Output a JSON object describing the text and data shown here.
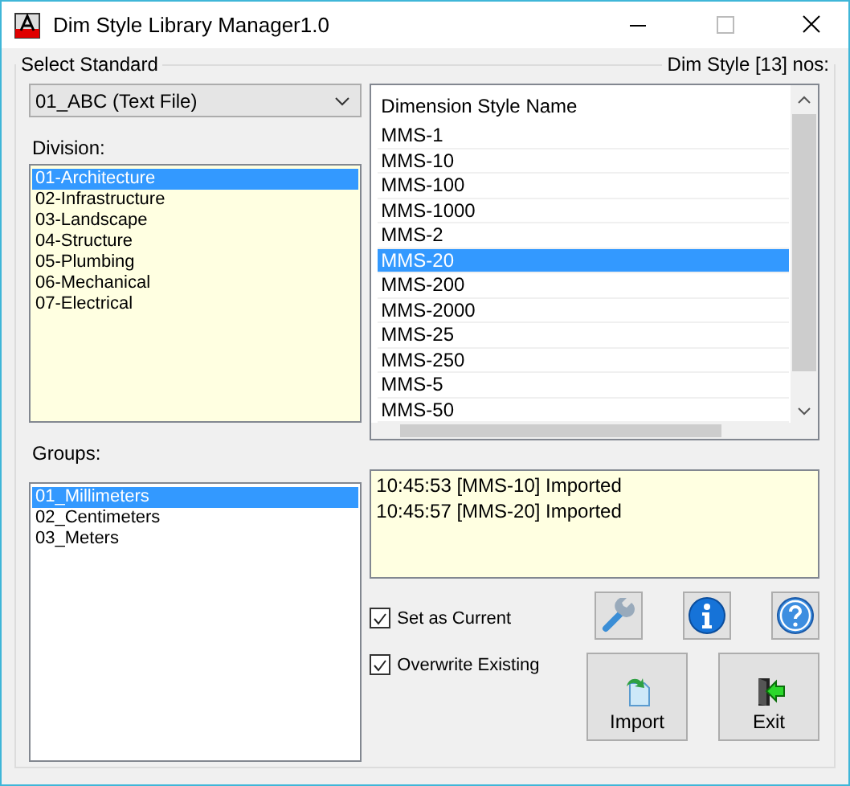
{
  "window": {
    "title": "Dim Style Library Manager1.0"
  },
  "standard": {
    "label": "Select Standard",
    "value": "01_ABC (Text File)"
  },
  "division": {
    "label": "Division:",
    "items": [
      {
        "text": "01-Architecture",
        "selected": true
      },
      {
        "text": "02-Infrastructure",
        "selected": false
      },
      {
        "text": "03-Landscape",
        "selected": false
      },
      {
        "text": "04-Structure",
        "selected": false
      },
      {
        "text": "05-Plumbing",
        "selected": false
      },
      {
        "text": "06-Mechanical",
        "selected": false
      },
      {
        "text": "07-Electrical",
        "selected": false
      }
    ]
  },
  "groups": {
    "label": "Groups:",
    "items": [
      {
        "text": "01_Millimeters",
        "selected": true
      },
      {
        "text": "02_Centimeters",
        "selected": false
      },
      {
        "text": "03_Meters",
        "selected": false
      }
    ]
  },
  "styles": {
    "count_label": "Dim Style [13] nos:",
    "column": "Dimension Style Name",
    "items": [
      {
        "text": "MMS-1",
        "selected": false
      },
      {
        "text": "MMS-10",
        "selected": false
      },
      {
        "text": "MMS-100",
        "selected": false
      },
      {
        "text": "MMS-1000",
        "selected": false
      },
      {
        "text": "MMS-2",
        "selected": false
      },
      {
        "text": "MMS-20",
        "selected": true
      },
      {
        "text": "MMS-200",
        "selected": false
      },
      {
        "text": "MMS-2000",
        "selected": false
      },
      {
        "text": "MMS-25",
        "selected": false
      },
      {
        "text": "MMS-250",
        "selected": false
      },
      {
        "text": "MMS-5",
        "selected": false
      },
      {
        "text": "MMS-50",
        "selected": false
      }
    ]
  },
  "log": [
    "10:45:53 [MMS-10] Imported",
    "10:45:57 [MMS-20] Imported"
  ],
  "options": [
    {
      "label": "Set as Current",
      "checked": true
    },
    {
      "label": "Overwrite Existing",
      "checked": true
    }
  ],
  "buttons": [
    {
      "label": "Import"
    },
    {
      "label": "Exit"
    }
  ]
}
